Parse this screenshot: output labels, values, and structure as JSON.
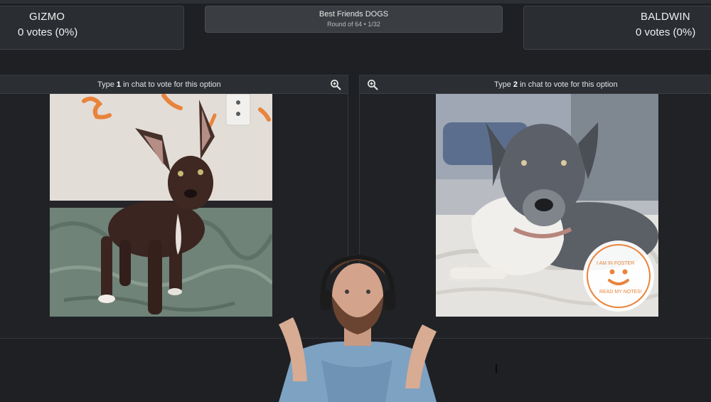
{
  "left_option": {
    "name": "GIZMO",
    "votes": "0 votes (0%)",
    "instruction_prefix": "Type ",
    "instruction_number": "1",
    "instruction_suffix": " in chat to vote for this option",
    "photo_label": "Brown puppy with large ears standing on a green blanket"
  },
  "right_option": {
    "name": "BALDWIN",
    "votes": "0 votes (0%)",
    "instruction_prefix": "Type ",
    "instruction_number": "2",
    "instruction_suffix": " in chat to vote for this option",
    "photo_label": "Grey and white dog lying on a bed",
    "badge": {
      "top_text": "I AM IN FOSTER",
      "bottom_text": "READ MY NOTES!"
    }
  },
  "round": {
    "title": "Best Friends DOGS",
    "subtitle": "Round of 64 • 1/32"
  },
  "icons": {
    "zoom": "zoom-in-icon"
  },
  "colors": {
    "background": "#1e2024",
    "panel": "#2a2d32",
    "accent_orange": "#e9843c"
  }
}
